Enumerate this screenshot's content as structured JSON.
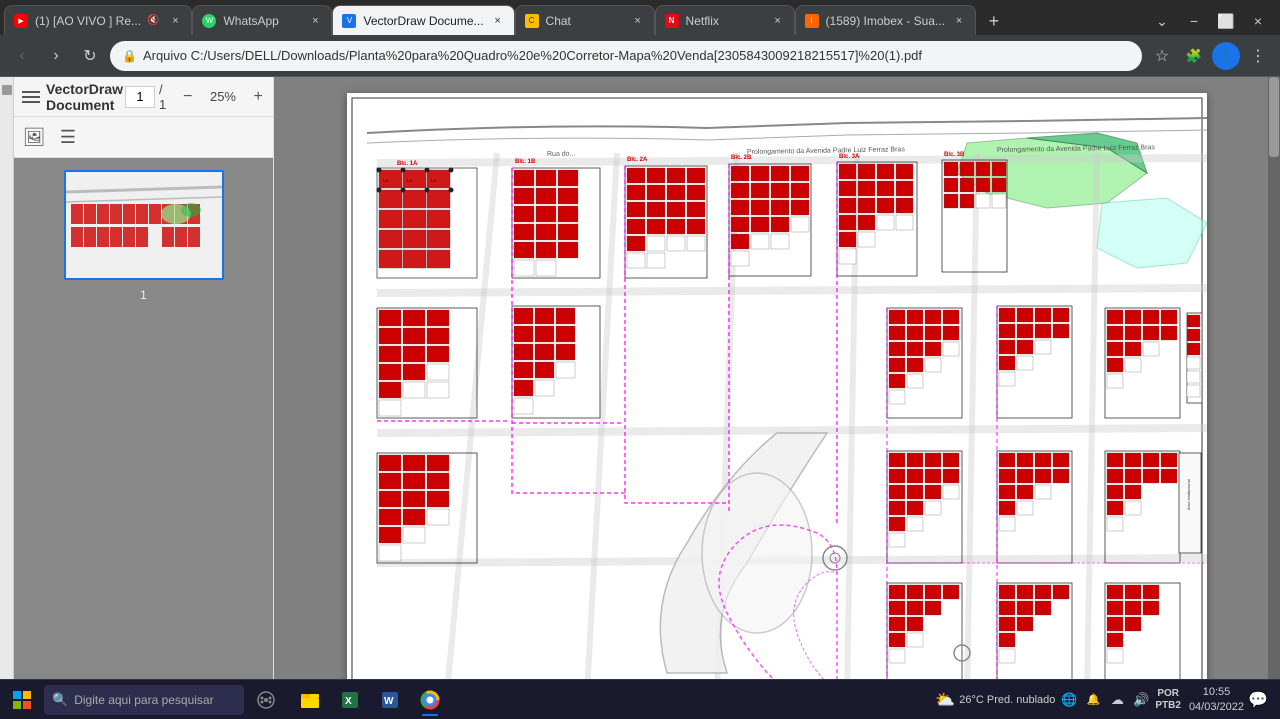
{
  "browser": {
    "tabs": [
      {
        "id": "tab-youtube",
        "favicon": "youtube",
        "title": "(1) [AO VIVO ] Re...",
        "active": false,
        "muted": true
      },
      {
        "id": "tab-whatsapp",
        "favicon": "whatsapp",
        "title": "WhatsApp",
        "active": false
      },
      {
        "id": "tab-vd",
        "favicon": "vd",
        "title": "VectorDraw Docume...",
        "active": true
      },
      {
        "id": "tab-chat",
        "favicon": "chat",
        "title": "Chat",
        "active": false
      },
      {
        "id": "tab-netflix",
        "favicon": "netflix",
        "title": "Netflix",
        "active": false
      },
      {
        "id": "tab-imobex",
        "favicon": "imobex",
        "title": "(1589) Imobex - Sua...",
        "active": false
      }
    ],
    "url": "Arquivo    C:/Users/DELL/Downloads/Planta%20para%20Quadro%20e%20Corretor-Mapa%20Venda[2305843009218215517]%20(1).pdf"
  },
  "vectordraw": {
    "title": "VectorDraw Document",
    "page_current": "1",
    "page_total": "1",
    "zoom": "25%",
    "page_label": "1"
  },
  "toolbar": {
    "download_label": "⬇",
    "print_label": "🖨",
    "menu_label": "⋮",
    "zoom_out": "−",
    "zoom_in": "+",
    "fullscreen": "⛶",
    "rotate": "↺"
  },
  "taskbar": {
    "search_placeholder": "Digite aqui para pesquisar",
    "weather": "26°C  Pred. nublado",
    "language_line1": "POR",
    "language_line2": "PTB2",
    "time": "10:55",
    "date": "04/03/2022"
  }
}
